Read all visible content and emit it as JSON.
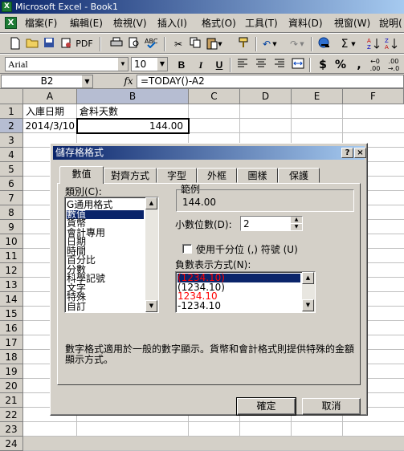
{
  "window": {
    "title": "Microsoft Excel - Book1",
    "app_icon": "excel-icon"
  },
  "menu": [
    "檔案(F)",
    "編輯(E)",
    "檢視(V)",
    "插入(I)",
    "格式(O)",
    "工具(T)",
    "資料(D)",
    "視窗(W)",
    "說明("
  ],
  "toolbar": {
    "pdf_label": "PDF",
    "sum_label": "Σ",
    "currency_label": "$",
    "percent_label": "%",
    "comma_label": ","
  },
  "format": {
    "font": "Arial",
    "size": "10",
    "bold": "B",
    "italic": "I",
    "underline": "U"
  },
  "formula_bar": {
    "name_box": "B2",
    "fx": "fx",
    "formula": "=TODAY()-A2"
  },
  "sheet": {
    "columns": [
      "A",
      "B",
      "C",
      "D",
      "E",
      "F"
    ],
    "rows": [
      "1",
      "2",
      "3",
      "4",
      "5",
      "6",
      "7",
      "8",
      "9",
      "10",
      "11",
      "12",
      "13",
      "14",
      "15",
      "16",
      "17",
      "18",
      "19",
      "20",
      "21",
      "22",
      "23",
      "24"
    ],
    "cells": {
      "A1": "入庫日期",
      "B1": "倉料天數",
      "A2": "2014/3/10",
      "B2": "144.00"
    }
  },
  "dialog": {
    "title": "儲存格格式",
    "help_btn": "?",
    "close_btn": "×",
    "tabs": [
      "數值",
      "對齊方式",
      "字型",
      "外框",
      "圖樣",
      "保護"
    ],
    "category_label": "類別(C):",
    "categories": [
      "G通用格式",
      "數值",
      "貨幣",
      "會計專用",
      "日期",
      "時間",
      "百分比",
      "分數",
      "科學記號",
      "文字",
      "特殊",
      "自訂"
    ],
    "selected_category": "數值",
    "sample_label": "範例",
    "sample_value": "144.00",
    "decimal_label": "小數位數(D):",
    "decimal_value": "2",
    "thousands_label": "使用千分位 (,) 符號 (U)",
    "negative_label": "負數表示方式(N):",
    "negatives": [
      "(1234.10)",
      "(1234.10)",
      "1234.10",
      "-1234.10"
    ],
    "negative_colors": [
      "#ff0000",
      "#000000",
      "#ff0000",
      "#000000"
    ],
    "description": "數字格式適用於一般的數字顯示。貨幣和會計格式則提供特殊的金額顯示方式。",
    "ok": "確定",
    "cancel": "取消"
  }
}
